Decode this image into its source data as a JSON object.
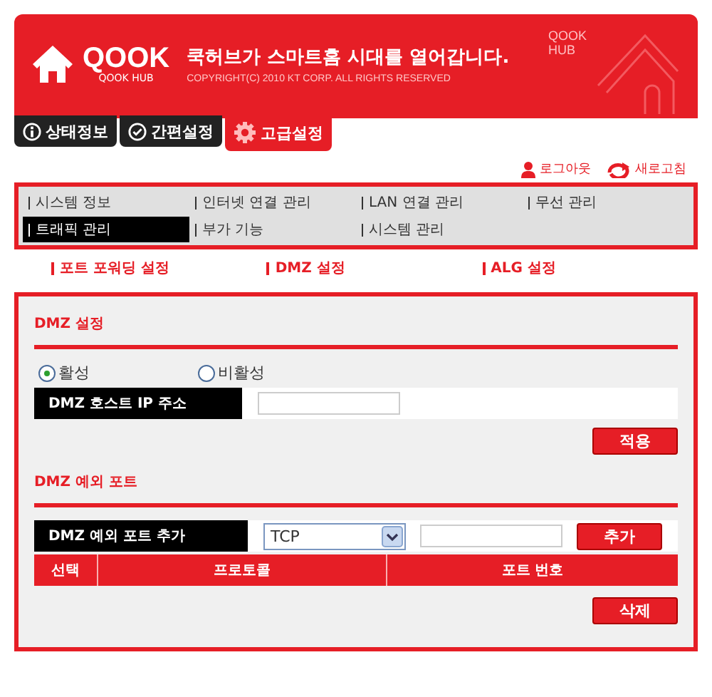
{
  "header": {
    "logo": "QOOK",
    "logo_sub": "QOOK HUB",
    "slogan": "쿡허브가 스마트홈 시대를 열어갑니다.",
    "copyright": "COPYRIGHT(C) 2010 KT CORP. ALL RIGHTS RESERVED",
    "deco_text": [
      "QOOK",
      "HUB"
    ]
  },
  "tabs": [
    {
      "label": "상태정보",
      "kind": "info",
      "selected": false
    },
    {
      "label": "간편설정",
      "kind": "check",
      "selected": false
    },
    {
      "label": "고급설정",
      "kind": "gear",
      "selected": true
    }
  ],
  "user_links": [
    {
      "label": "로그아웃",
      "kind": "person"
    },
    {
      "label": "새로고침",
      "kind": "refresh"
    }
  ],
  "menu": [
    {
      "label": "시스템 정보",
      "selected": false
    },
    {
      "label": "인터넷 연결 관리",
      "selected": false
    },
    {
      "label": "LAN 연결 관리",
      "selected": false
    },
    {
      "label": "무선 관리",
      "selected": false
    },
    {
      "label": "트래픽 관리",
      "selected": true
    },
    {
      "label": "부가 기능",
      "selected": false
    },
    {
      "label": "시스템 관리",
      "selected": false
    }
  ],
  "subnav": [
    "포트 포워딩 설정",
    "DMZ 설정",
    "ALG 설정"
  ],
  "dmz": {
    "title": "DMZ 설정",
    "radios": [
      {
        "label": "활성",
        "selected": true
      },
      {
        "label": "비활성",
        "selected": false
      }
    ],
    "host_ip_label": "DMZ 호스트 IP 주소",
    "apply_button": "적용"
  },
  "exceptions": {
    "title": "DMZ 예외 포트",
    "add_label": "DMZ 예외 포트 추가",
    "protocol": "TCP",
    "add_button": "추가",
    "table": {
      "columns": [
        "선택",
        "프로토콜",
        "포트 번호"
      ]
    },
    "delete_button": "삭제"
  }
}
